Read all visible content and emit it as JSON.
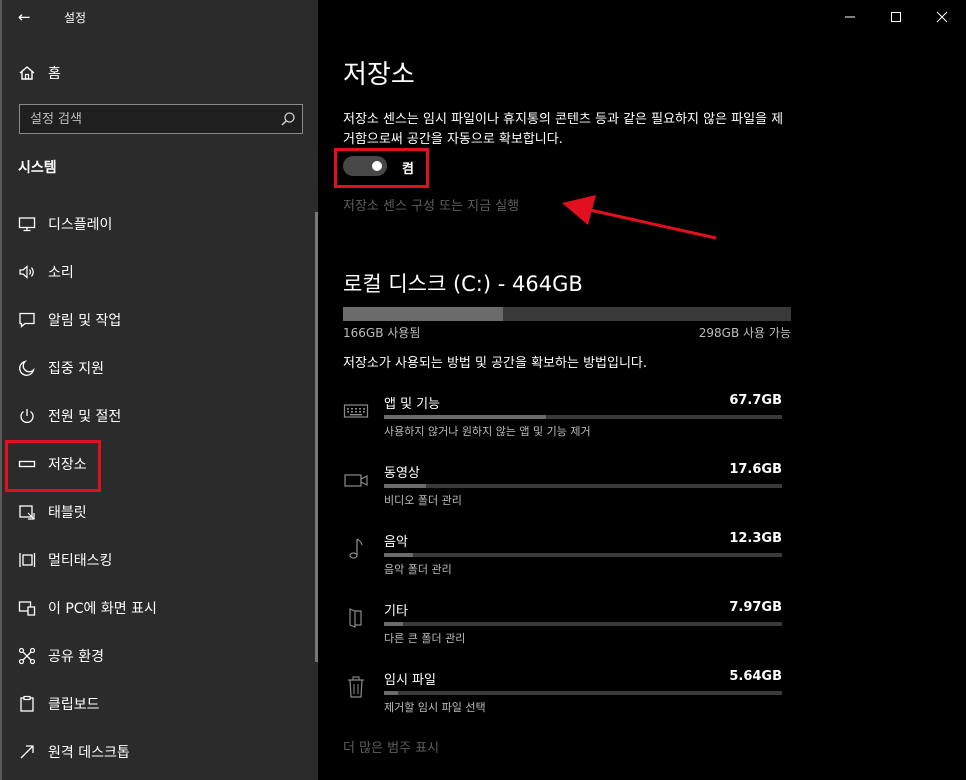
{
  "window": {
    "title": "설정"
  },
  "sidebar": {
    "home_label": "홈",
    "search_placeholder": "설정 검색",
    "section_title": "시스템",
    "items": [
      {
        "label": "디스플레이",
        "icon": "display-icon"
      },
      {
        "label": "소리",
        "icon": "speaker-icon"
      },
      {
        "label": "알림 및 작업",
        "icon": "notification-icon"
      },
      {
        "label": "집중 지원",
        "icon": "moon-icon"
      },
      {
        "label": "전원 및 절전",
        "icon": "power-icon"
      },
      {
        "label": "저장소",
        "icon": "storage-icon",
        "selected": true
      },
      {
        "label": "태블릿",
        "icon": "tablet-icon"
      },
      {
        "label": "멀티태스킹",
        "icon": "multitasking-icon"
      },
      {
        "label": "이 PC에 화면 표시",
        "icon": "project-icon"
      },
      {
        "label": "공유 환경",
        "icon": "shared-icon"
      },
      {
        "label": "클립보드",
        "icon": "clipboard-icon"
      },
      {
        "label": "원격 데스크톱",
        "icon": "remote-desktop-icon"
      }
    ]
  },
  "main": {
    "title": "저장소",
    "description": "저장소 센스는 임시 파일이나 휴지통의 콘텐츠 등과 같은 필요하지 않은 파일을 제거함으로써 공간을 자동으로 확보합니다.",
    "toggle": {
      "state": "on",
      "label": "켬"
    },
    "configure_link": "저장소 센스 구성 또는 지금 실행",
    "disk": {
      "title": "로컬 디스크 (C:) - 464GB",
      "used_label": "166GB 사용됨",
      "available_label": "298GB 사용 가능",
      "used_fraction": 0.357
    },
    "usage_heading": "저장소가 사용되는 방법 및 공간을 확보하는 방법입니다.",
    "categories": [
      {
        "name": "앱 및 기능",
        "size": "67.7GB",
        "subtitle": "사용하지 않거나 원하지 않는 앱 및 기능 제거",
        "fraction": 0.408,
        "icon": "keyboard-icon"
      },
      {
        "name": "동영상",
        "size": "17.6GB",
        "subtitle": "비디오 폴더 관리",
        "fraction": 0.106,
        "icon": "video-icon"
      },
      {
        "name": "음악",
        "size": "12.3GB",
        "subtitle": "음악 폴더 관리",
        "fraction": 0.074,
        "icon": "music-icon"
      },
      {
        "name": "기타",
        "size": "7.97GB",
        "subtitle": "다른 큰 폴더 관리",
        "fraction": 0.048,
        "icon": "other-folder-icon"
      },
      {
        "name": "임시 파일",
        "size": "5.64GB",
        "subtitle": "제거할 임시 파일 선택",
        "fraction": 0.034,
        "icon": "trash-icon"
      }
    ],
    "more_link": "더 많은 범주 표시"
  },
  "colors": {
    "highlight": "#e10f1f",
    "sidebar_bg": "#2b2b2b",
    "main_bg": "#000000"
  }
}
